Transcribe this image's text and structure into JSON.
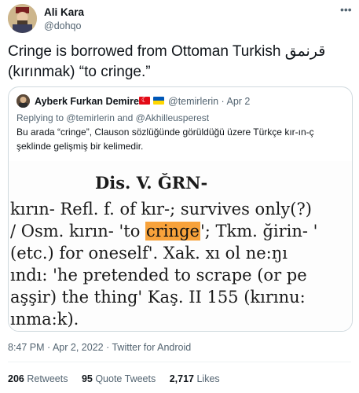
{
  "author": {
    "name": "Ali Kara",
    "handle": "@dohqo"
  },
  "more_icon": "•••",
  "tweet_text_line1": "Cringe is borrowed from Ottoman Turkish قرنمق",
  "tweet_text_line2": "(kırınmak) “to cringe.”",
  "quote": {
    "name": "Ayberk Furkan Demirel",
    "flags": [
      "turkey-flag",
      "ukraine-flag"
    ],
    "handle_date": "@temirlerin · Apr 2",
    "reply_prefix": "Replying to ",
    "reply_users": "@temirlerin and @Akhilleusperest",
    "text": "Bu arada “cringe”, Clauson sözlüğünde görüldüğü üzere Türkçe kır-ın-ç şeklinde gelişmiş bir kelimedir.",
    "scan": {
      "heading": "Dis. V. ĞRN-",
      "line1": "kırın- Refl. f. of kır-; survives only(?)",
      "line2_before": "/ Osm. kırın- 'to ",
      "line2_highlight": "cringe",
      "line2_after": "'; Tkm. ğirin- '",
      "line3": "(etc.) for oneself'. Xak. xı ol ne:ŋı",
      "line4": "ındı: 'he pretended to scrape (or pe",
      "line5": "aşşir) the thing' Kaş. II 155 (kırınu:",
      "line6": "ınma:k)."
    }
  },
  "meta": "8:47 PM · Apr 2, 2022 · Twitter for Android",
  "stats": {
    "retweets_count": "206",
    "retweets_label": "Retweets",
    "quotes_count": "95",
    "quotes_label": "Quote Tweets",
    "likes_count": "2,717",
    "likes_label": "Likes"
  }
}
